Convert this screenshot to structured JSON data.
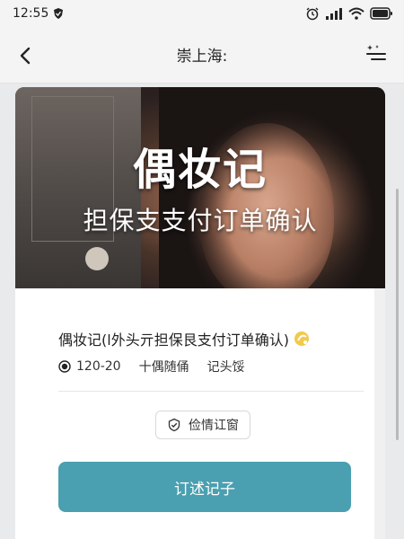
{
  "status_bar": {
    "time": "12:55",
    "icons": [
      "shield-icon",
      "alarm-icon",
      "signal-icon",
      "wifi-icon",
      "battery-icon"
    ]
  },
  "nav": {
    "title": "崇上海:",
    "back_icon": "chevron-left-icon",
    "more_icon": "sparkle-menu-icon"
  },
  "banner": {
    "title": "偶妆记",
    "subtitle": "担保支支付订单确认"
  },
  "order": {
    "title": "偶妆记(l外头亓担保艮支付订单确认)",
    "title_icon": "sparkle-icon",
    "meta": {
      "time_range": "120-20",
      "tag1": "十偶随俑",
      "tag2": "记头馁"
    },
    "detail_button_label": "俭情讧窗",
    "primary_button_label": "订述记子"
  },
  "colors": {
    "primary": "#4a9fb0",
    "background": "#e9eaec",
    "card": "#ffffff"
  }
}
